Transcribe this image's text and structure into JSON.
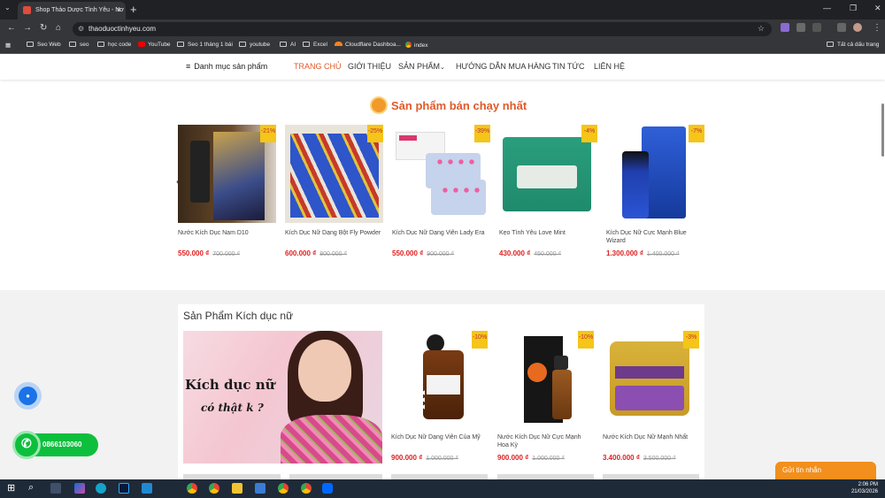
{
  "browser": {
    "tab_title": "Shop Thảo Dược Tình Yêu - Nơ",
    "url": "thaoduoctinhyeu.com",
    "bookmarks": [
      "Seo Web",
      "seo",
      "học code",
      "YouTube",
      "Seo 1 tháng 1 bài",
      "youtube",
      "AI",
      "Excel",
      "Cloudflare Dashboa...",
      "index"
    ],
    "all_bookmarks": "Tất cả dấu trang"
  },
  "nav": {
    "category_menu": "Danh mục sản phẩm",
    "items": [
      "TRANG CHỦ",
      "GIỚI THIỆU",
      "SẢN PHẨM",
      "HƯỚNG DẪN MUA HÀNG",
      "TIN TỨC",
      "LIÊN HỆ"
    ],
    "active": "TRANG CHỦ",
    "active_color": "#e05a2a"
  },
  "bestsellers": {
    "title": "Sản phẩm bán chạy nhất",
    "products": [
      {
        "name": "Nước Kích Dục Nam D10",
        "price": "550.000 ₫",
        "old_price": "700.000 ₫",
        "discount": "-21%"
      },
      {
        "name": "Kích Dục Nữ Dạng Bột Fly Powder",
        "price": "600.000 ₫",
        "old_price": "800.000 ₫",
        "discount": "-25%"
      },
      {
        "name": "Kích Dục Nữ Dạng Viên Lady Era",
        "price": "550.000 ₫",
        "old_price": "900.000 ₫",
        "discount": "-39%"
      },
      {
        "name": "Kẹo Tình Yêu Love Mint",
        "price": "430.000 ₫",
        "old_price": "450.000 ₫",
        "discount": "-4%"
      },
      {
        "name": "Kích Dục Nữ Cực Mạnh Blue Wizard",
        "price": "1.300.000 ₫",
        "old_price": "1.400.000 ₫",
        "discount": "-7%"
      }
    ]
  },
  "female_section": {
    "title": "Sản Phẩm Kích dục nữ",
    "banner_line1": "Kích dục nữ",
    "banner_line2": "có thật k ?",
    "products": [
      {
        "name": "Kích Dục Nữ Dạng Viên Của Mỹ",
        "price": "900.000 ₫",
        "old_price": "1.000.000 ₫",
        "discount": "-10%"
      },
      {
        "name": "Nước Kích Dục Nữ Cực Mạnh Hoa Kỳ",
        "price": "900.000 ₫",
        "old_price": "1.000.000 ₫",
        "discount": "-10%"
      },
      {
        "name": "Nước Kích Dục Nữ Mạnh Nhất",
        "price": "3.400.000 ₫",
        "old_price": "3.500.000 ₫",
        "discount": "-3%"
      }
    ]
  },
  "contact": {
    "phone": "0866103060",
    "send_message": "Gửi tin nhắn"
  },
  "taskbar": {
    "time": "2:06 PM",
    "date": "21/03/2026"
  }
}
